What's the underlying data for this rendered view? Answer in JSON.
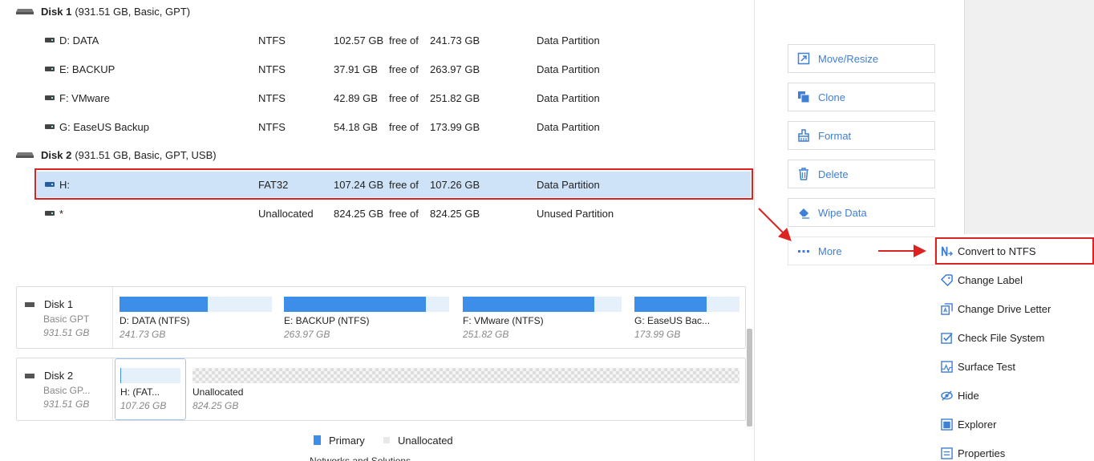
{
  "disks": [
    {
      "name": "Disk 1",
      "details": "(931.51 GB, Basic, GPT)",
      "partitions": [
        {
          "name": "D: DATA",
          "fs": "NTFS",
          "free": "102.57 GB",
          "of": "free of",
          "total": "241.73 GB",
          "type": "Data Partition"
        },
        {
          "name": "E: BACKUP",
          "fs": "NTFS",
          "free": "37.91 GB",
          "of": "free of",
          "total": "263.97 GB",
          "type": "Data Partition"
        },
        {
          "name": "F: VMware",
          "fs": "NTFS",
          "free": "42.89 GB",
          "of": "free of",
          "total": "251.82 GB",
          "type": "Data Partition"
        },
        {
          "name": "G: EaseUS Backup",
          "fs": "NTFS",
          "free": "54.18 GB",
          "of": "free of",
          "total": "173.99 GB",
          "type": "Data Partition"
        }
      ]
    },
    {
      "name": "Disk 2",
      "details": "(931.51 GB, Basic, GPT, USB)",
      "partitions": [
        {
          "name": "H:",
          "fs": "FAT32",
          "free": "107.24 GB",
          "of": "free of",
          "total": "107.26 GB",
          "type": "Data Partition"
        },
        {
          "name": "*",
          "fs": "Unallocated",
          "free": "824.25 GB",
          "of": "free of",
          "total": "824.25 GB",
          "type": "Unused Partition"
        }
      ]
    }
  ],
  "disk_map": {
    "disk1": {
      "title": "Disk 1",
      "style": "Basic GPT",
      "size": "931.51 GB",
      "blocks": [
        {
          "label": "D: DATA (NTFS)",
          "size": "241.73 GB",
          "used_fraction": 0.58
        },
        {
          "label": "E: BACKUP (NTFS)",
          "size": "263.97 GB",
          "used_fraction": 0.86
        },
        {
          "label": "F: VMware (NTFS)",
          "size": "251.82 GB",
          "used_fraction": 0.83
        },
        {
          "label": "G: EaseUS Bac...",
          "size": "173.99 GB",
          "used_fraction": 0.69
        }
      ]
    },
    "disk2": {
      "title": "Disk 2",
      "style": "Basic GP...",
      "size": "931.51 GB",
      "blocks": [
        {
          "label": "H:  (FAT...",
          "size": "107.26 GB",
          "used_fraction": 0.0
        },
        {
          "label": "Unallocated",
          "size": "824.25 GB"
        }
      ]
    }
  },
  "legend": {
    "primary": "Primary",
    "unallocated": "Unallocated",
    "primary_color": "#3d8ee8",
    "unallocated_color": "#e0e0e0"
  },
  "actions": [
    {
      "label": "Move/Resize",
      "icon": "move-resize-icon"
    },
    {
      "label": "Clone",
      "icon": "clone-icon"
    },
    {
      "label": "Format",
      "icon": "format-icon"
    },
    {
      "label": "Delete",
      "icon": "delete-icon"
    },
    {
      "label": "Wipe Data",
      "icon": "wipe-data-icon"
    },
    {
      "label": "More",
      "icon": "more-icon"
    }
  ],
  "more_menu": [
    {
      "label": "Convert to NTFS",
      "icon": "convert-ntfs-icon"
    },
    {
      "label": "Change Label",
      "icon": "tag-icon"
    },
    {
      "label": "Change Drive Letter",
      "icon": "drive-letter-icon"
    },
    {
      "label": "Check File System",
      "icon": "check-icon"
    },
    {
      "label": "Surface Test",
      "icon": "surface-test-icon"
    },
    {
      "label": "Hide",
      "icon": "hide-icon"
    },
    {
      "label": "Explorer",
      "icon": "explorer-icon"
    },
    {
      "label": "Properties",
      "icon": "properties-icon"
    }
  ],
  "colors": {
    "accent": "#3f7fd6",
    "selection": "#cfe3f8",
    "highlight_border": "#dd2222"
  },
  "footer_cut_text": "Networks and Solutions"
}
